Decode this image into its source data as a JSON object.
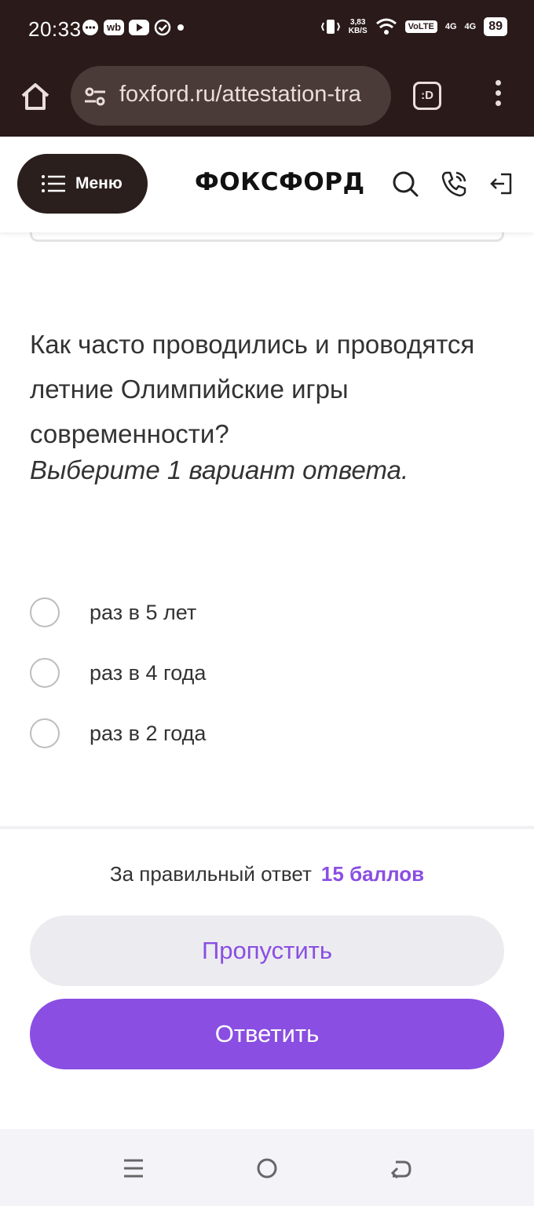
{
  "status_bar": {
    "time": "20:33",
    "chip_label": "wb",
    "net_speed": "3,83\nKB/S",
    "volte": "VoLTE",
    "sim1": "4G",
    "sim2": "4G",
    "battery": "89"
  },
  "browser": {
    "url": "foxford.ru/attestation-tra",
    "tabs_label": ":D"
  },
  "header": {
    "menu_label": "Меню",
    "logo": "ФОКСФОРД"
  },
  "question": {
    "text": "Как часто проводились и проводятся летние Олимпийские игры современности?",
    "hint": "Выберите 1 вариант ответа.",
    "options": [
      {
        "label": "раз в 5 лет"
      },
      {
        "label": "раз в 4 года"
      },
      {
        "label": "раз в 2 года"
      }
    ]
  },
  "footer": {
    "points_text": "За правильный ответ",
    "points_value": "15 баллов",
    "skip_label": "Пропустить",
    "answer_label": "Ответить"
  },
  "colors": {
    "accent": "#8a4ee2",
    "chrome": "#2a1a1a"
  }
}
